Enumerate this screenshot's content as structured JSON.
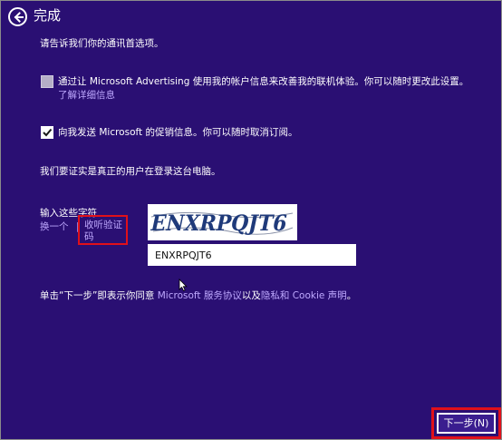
{
  "header": {
    "back_icon": "back-arrow-icon",
    "title": "完成"
  },
  "intro": "请告诉我们你的通讯首选项。",
  "options": {
    "advertising": {
      "checked": false,
      "label": "通过让 Microsoft Advertising 使用我的帐户信息来改善我的联机体验。你可以随时更改此设置。",
      "link": "了解详细信息"
    },
    "promotions": {
      "checked": true,
      "label": "向我发送 Microsoft 的促销信息。你可以随时取消订阅。"
    }
  },
  "verify": {
    "intro": "我们要证实是真正的用户在登录这台电脑。",
    "captcha_label": "输入这些字符",
    "change_link": "换一个",
    "separator": "|",
    "listen_link": "收听验证码",
    "captcha_image_text": "ENXRPQJT6",
    "captcha_value": "ENXRPQJT6"
  },
  "legal": {
    "prefix": "单击“下一步”即表示你同意",
    "service_link": "Microsoft 服务协议",
    "middle": "以及",
    "privacy_link": "隐私和 Cookie 声明",
    "suffix": "。"
  },
  "footer": {
    "next_label": "下一步(N)"
  },
  "colors": {
    "background": "#2a0f73",
    "link": "#bfa9ff",
    "highlight": "#e0101a",
    "checkbox_unchecked": "#b5afc7"
  }
}
